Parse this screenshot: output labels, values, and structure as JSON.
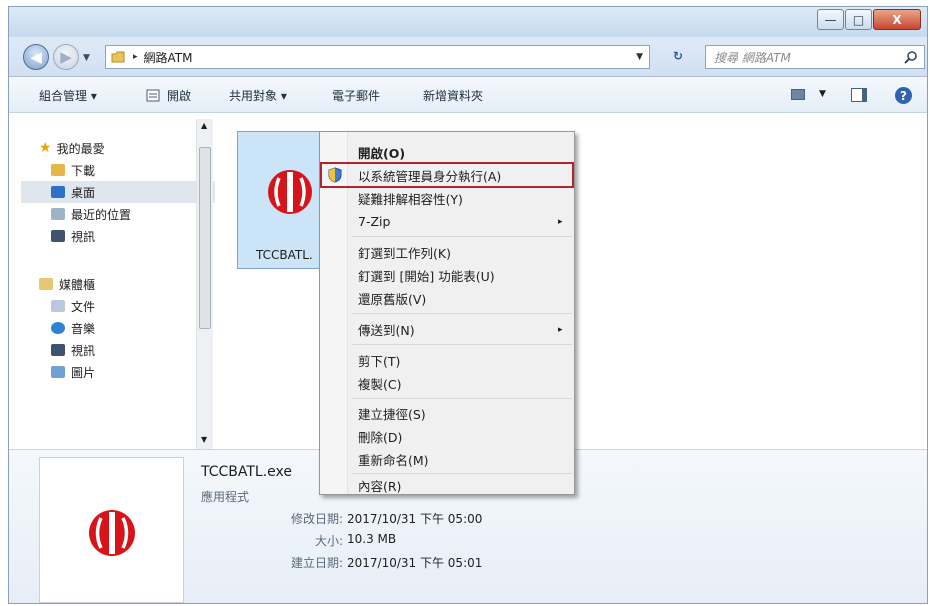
{
  "window": {
    "minimize": "—",
    "maximize": "□",
    "close": "X"
  },
  "address": {
    "breadcrumb_sep": "▸",
    "path": "網路ATM",
    "search_placeholder": "搜尋 網路ATM"
  },
  "toolbar": {
    "organize": "組合管理 ▾",
    "open": "開啟",
    "share": "共用對象 ▾",
    "email": "電子郵件",
    "new_folder": "新增資料夾"
  },
  "nav": {
    "favorites": "我的最愛",
    "downloads": "下載",
    "desktop": "桌面",
    "recent": "最近的位置",
    "videos": "視訊",
    "libraries": "媒體櫃",
    "documents": "文件",
    "music": "音樂",
    "videos2": "視訊",
    "pictures": "圖片"
  },
  "file": {
    "name_short": "TCCBATL."
  },
  "details": {
    "filename": "TCCBATL.exe",
    "type": "應用程式",
    "modified_label": "修改日期:",
    "modified_value": "2017/10/31 下午 05:00",
    "size_label": "大小:",
    "size_value": "10.3 MB",
    "created_label": "建立日期:",
    "created_value": "2017/10/31 下午 05:01"
  },
  "context_menu": {
    "open": "開啟(O)",
    "run_as_admin": "以系統管理員身分執行(A)",
    "troubleshoot": "疑難排解相容性(Y)",
    "sevenzip": "7-Zip",
    "pin_taskbar": "釘選到工作列(K)",
    "pin_start": "釘選到 [開始] 功能表(U)",
    "restore": "還原舊版(V)",
    "send_to": "傳送到(N)",
    "cut": "剪下(T)",
    "copy": "複製(C)",
    "create_shortcut": "建立捷徑(S)",
    "delete": "刪除(D)",
    "rename": "重新命名(M)",
    "properties": "內容(R)",
    "arrow": "▸"
  },
  "colors": {
    "highlight_box": "#b0262e",
    "logo_red": "#d7141a"
  }
}
